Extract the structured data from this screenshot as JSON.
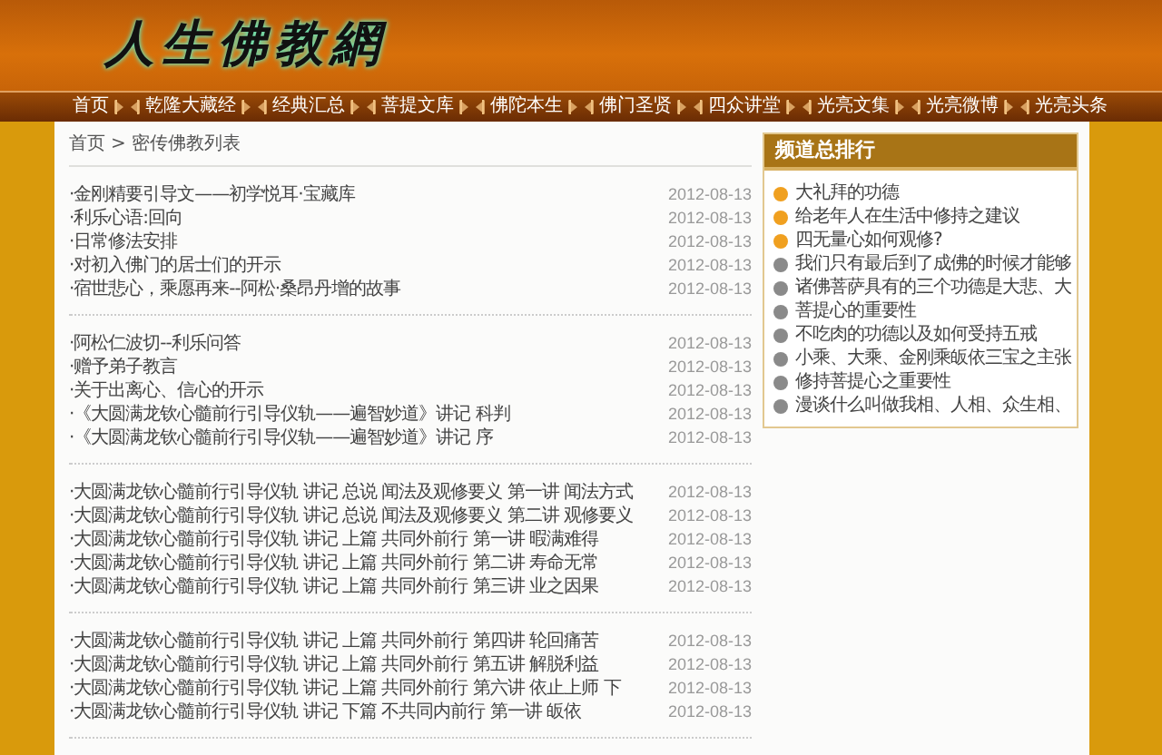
{
  "site": {
    "logo": "人生佛教網"
  },
  "nav": {
    "items": [
      {
        "label": "首页"
      },
      {
        "label": "乾隆大藏经"
      },
      {
        "label": "经典汇总"
      },
      {
        "label": "菩提文库"
      },
      {
        "label": "佛陀本生"
      },
      {
        "label": "佛门圣贤"
      },
      {
        "label": "四众讲堂"
      },
      {
        "label": "光亮文集"
      },
      {
        "label": "光亮微博"
      },
      {
        "label": "光亮头条"
      }
    ]
  },
  "breadcrumb": {
    "home": "首页",
    "separator": ">",
    "current": "密传佛教列表"
  },
  "article_groups": [
    {
      "items": [
        {
          "title": "·金刚精要引导文——初学悦耳·宝藏库",
          "date": "2012-08-13"
        },
        {
          "title": "·利乐心语:回向",
          "date": "2012-08-13"
        },
        {
          "title": "·日常修法安排",
          "date": "2012-08-13"
        },
        {
          "title": "·对初入佛门的居士们的开示",
          "date": "2012-08-13"
        },
        {
          "title": "·宿世悲心，乘愿再来--阿松·桑昂丹增的故事",
          "date": "2012-08-13"
        }
      ]
    },
    {
      "items": [
        {
          "title": "·阿松仁波切--利乐问答",
          "date": "2012-08-13"
        },
        {
          "title": "·赠予弟子教言",
          "date": "2012-08-13"
        },
        {
          "title": "·关于出离心、信心的开示",
          "date": "2012-08-13"
        },
        {
          "title": "·《大圆满龙钦心髓前行引导仪轨——遍智妙道》讲记 科判",
          "date": "2012-08-13"
        },
        {
          "title": "·《大圆满龙钦心髓前行引导仪轨——遍智妙道》讲记 序",
          "date": "2012-08-13"
        }
      ]
    },
    {
      "items": [
        {
          "title": "·大圆满龙钦心髓前行引导仪轨 讲记 总说 闻法及观修要义 第一讲 闻法方式",
          "date": "2012-08-13"
        },
        {
          "title": "·大圆满龙钦心髓前行引导仪轨 讲记 总说 闻法及观修要义 第二讲 观修要义",
          "date": "2012-08-13"
        },
        {
          "title": "·大圆满龙钦心髓前行引导仪轨 讲记 上篇 共同外前行 第一讲 暇满难得",
          "date": "2012-08-13"
        },
        {
          "title": "·大圆满龙钦心髓前行引导仪轨 讲记 上篇 共同外前行 第二讲 寿命无常",
          "date": "2012-08-13"
        },
        {
          "title": "·大圆满龙钦心髓前行引导仪轨 讲记 上篇 共同外前行 第三讲 业之因果",
          "date": "2012-08-13"
        }
      ]
    },
    {
      "items": [
        {
          "title": "·大圆满龙钦心髓前行引导仪轨 讲记 上篇 共同外前行 第四讲 轮回痛苦",
          "date": "2012-08-13"
        },
        {
          "title": "·大圆满龙钦心髓前行引导仪轨 讲记 上篇 共同外前行 第五讲 解脱利益",
          "date": "2012-08-13"
        },
        {
          "title": "·大圆满龙钦心髓前行引导仪轨 讲记 上篇 共同外前行 第六讲 依止上师 下",
          "date": "2012-08-13"
        },
        {
          "title": "·大圆满龙钦心髓前行引导仪轨 讲记 下篇 不共同内前行 第一讲 皈依",
          "date": "2012-08-13"
        }
      ]
    }
  ],
  "ranking": {
    "title": "频道总排行",
    "items": [
      {
        "title": "大礼拜的功德",
        "color": "#f0a020"
      },
      {
        "title": "给老年人在生活中修持之建议",
        "color": "#f0a020"
      },
      {
        "title": "四无量心如何观修?",
        "color": "#f0a020"
      },
      {
        "title": "我们只有最后到了成佛的时候才能够",
        "color": "#8a8a8a"
      },
      {
        "title": "诸佛菩萨具有的三个功德是大悲、大",
        "color": "#8a8a8a"
      },
      {
        "title": "菩提心的重要性",
        "color": "#8a8a8a"
      },
      {
        "title": "不吃肉的功德以及如何受持五戒",
        "color": "#8a8a8a"
      },
      {
        "title": "小乘、大乘、金刚乘皈依三宝之主张",
        "color": "#8a8a8a"
      },
      {
        "title": "修持菩提心之重要性",
        "color": "#8a8a8a"
      },
      {
        "title": "漫谈什么叫做我相、人相、众生相、",
        "color": "#8a8a8a"
      }
    ]
  }
}
